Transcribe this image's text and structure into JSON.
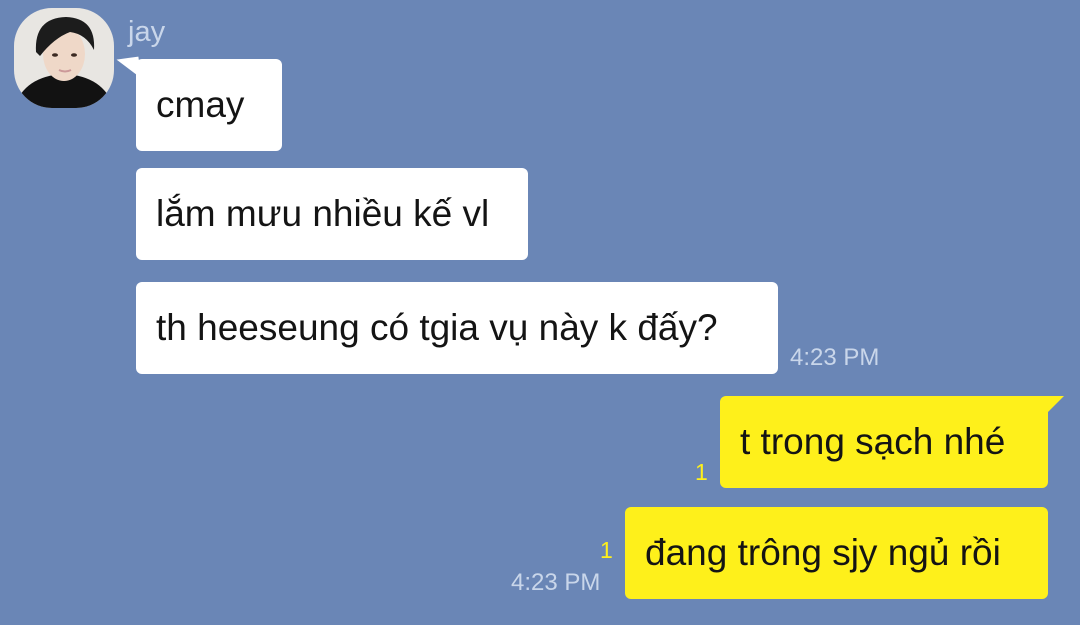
{
  "contact": {
    "name": "jay"
  },
  "messages": [
    {
      "text": "cmay"
    },
    {
      "text": "lắm mưu nhiều kế vl"
    },
    {
      "text": "th heeseung có tgia vụ này k đấy?",
      "time": "4:23 PM"
    },
    {
      "text": "t trong sạch nhé",
      "unread": "1"
    },
    {
      "text": "đang trông sjy ngủ rồi",
      "unread": "1",
      "time": "4:23 PM"
    }
  ],
  "colors": {
    "background": "#6a86b6",
    "incoming": "#ffffff",
    "outgoing": "#fef01b"
  }
}
